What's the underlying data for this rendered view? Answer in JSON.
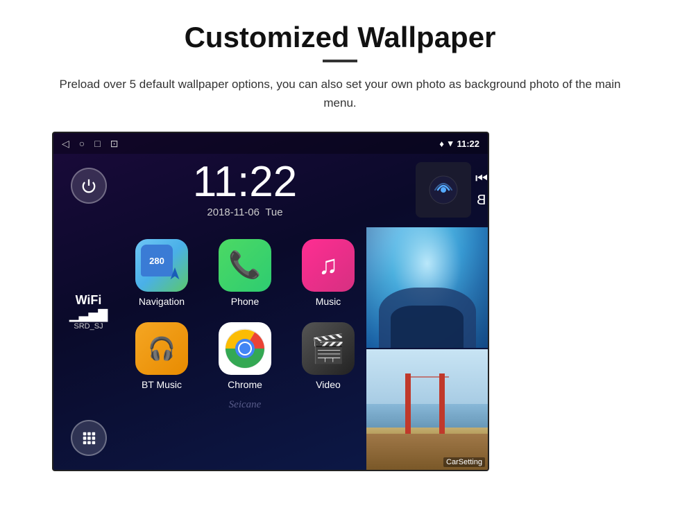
{
  "page": {
    "title": "Customized Wallpaper",
    "divider": true,
    "description": "Preload over 5 default wallpaper options, you can also set your own photo as background photo of the main menu."
  },
  "android": {
    "status_bar": {
      "back_icon": "◁",
      "home_icon": "○",
      "recents_icon": "□",
      "screenshot_icon": "⊡",
      "location_icon": "♦",
      "wifi_icon": "▾",
      "time": "11:22"
    },
    "clock": {
      "time": "11:22",
      "date": "2018-11-06",
      "day": "Tue"
    },
    "wifi": {
      "label": "WiFi",
      "ssid": "SRD_SJ"
    },
    "apps": [
      {
        "id": "navigation",
        "label": "Navigation",
        "icon_type": "navigation"
      },
      {
        "id": "phone",
        "label": "Phone",
        "icon_type": "phone"
      },
      {
        "id": "music",
        "label": "Music",
        "icon_type": "music"
      },
      {
        "id": "bt-music",
        "label": "BT Music",
        "icon_type": "bt-music"
      },
      {
        "id": "chrome",
        "label": "Chrome",
        "icon_type": "chrome"
      },
      {
        "id": "video",
        "label": "Video",
        "icon_type": "video"
      }
    ],
    "watermark": "Seicane",
    "car_setting_label": "CarSetting",
    "nav_number": "280"
  }
}
